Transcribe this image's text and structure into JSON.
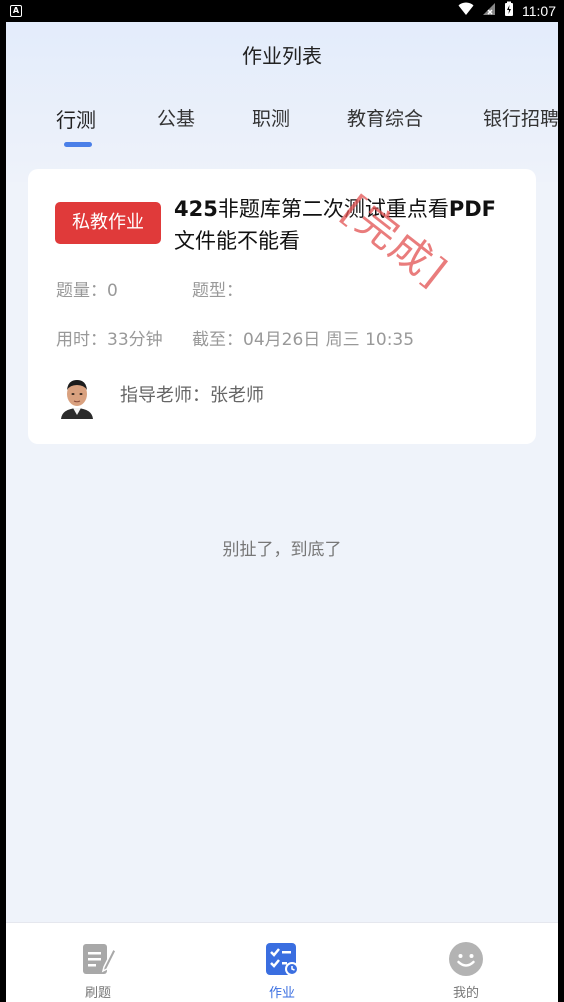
{
  "status_bar": {
    "app_indicator": "A",
    "time": "11:07"
  },
  "header": {
    "title": "作业列表"
  },
  "tabs": [
    {
      "label": "行测",
      "active": true
    },
    {
      "label": "公基",
      "active": false
    },
    {
      "label": "职测",
      "active": false
    },
    {
      "label": "教育综合",
      "active": false
    },
    {
      "label": "银行招聘",
      "active": false
    }
  ],
  "homework_card": {
    "badge": "私教作业",
    "title_bold": "425",
    "title_line1_rest": "非题库第二次测试重点看",
    "title_bold_end": "PDF",
    "title_line2": "文件能不能看",
    "question_count": "题量：0",
    "question_type": "题型：",
    "time_used": "用时：33分钟",
    "deadline": "截至：04月26日 周三 10:35",
    "teacher": "指导老师：张老师",
    "stamp": "[完成]",
    "stamp_color": "#e25050"
  },
  "list_end_text": "别扯了，到底了",
  "bottom_nav": [
    {
      "label": "刷题",
      "icon": "edit-list-icon",
      "active": false
    },
    {
      "label": "作业",
      "icon": "homework-icon",
      "active": true
    },
    {
      "label": "我的",
      "icon": "smiley-icon",
      "active": false
    }
  ],
  "colors": {
    "accent": "#3a6ee0",
    "badge_red": "#e03a3a",
    "background": "#eff3fa"
  }
}
